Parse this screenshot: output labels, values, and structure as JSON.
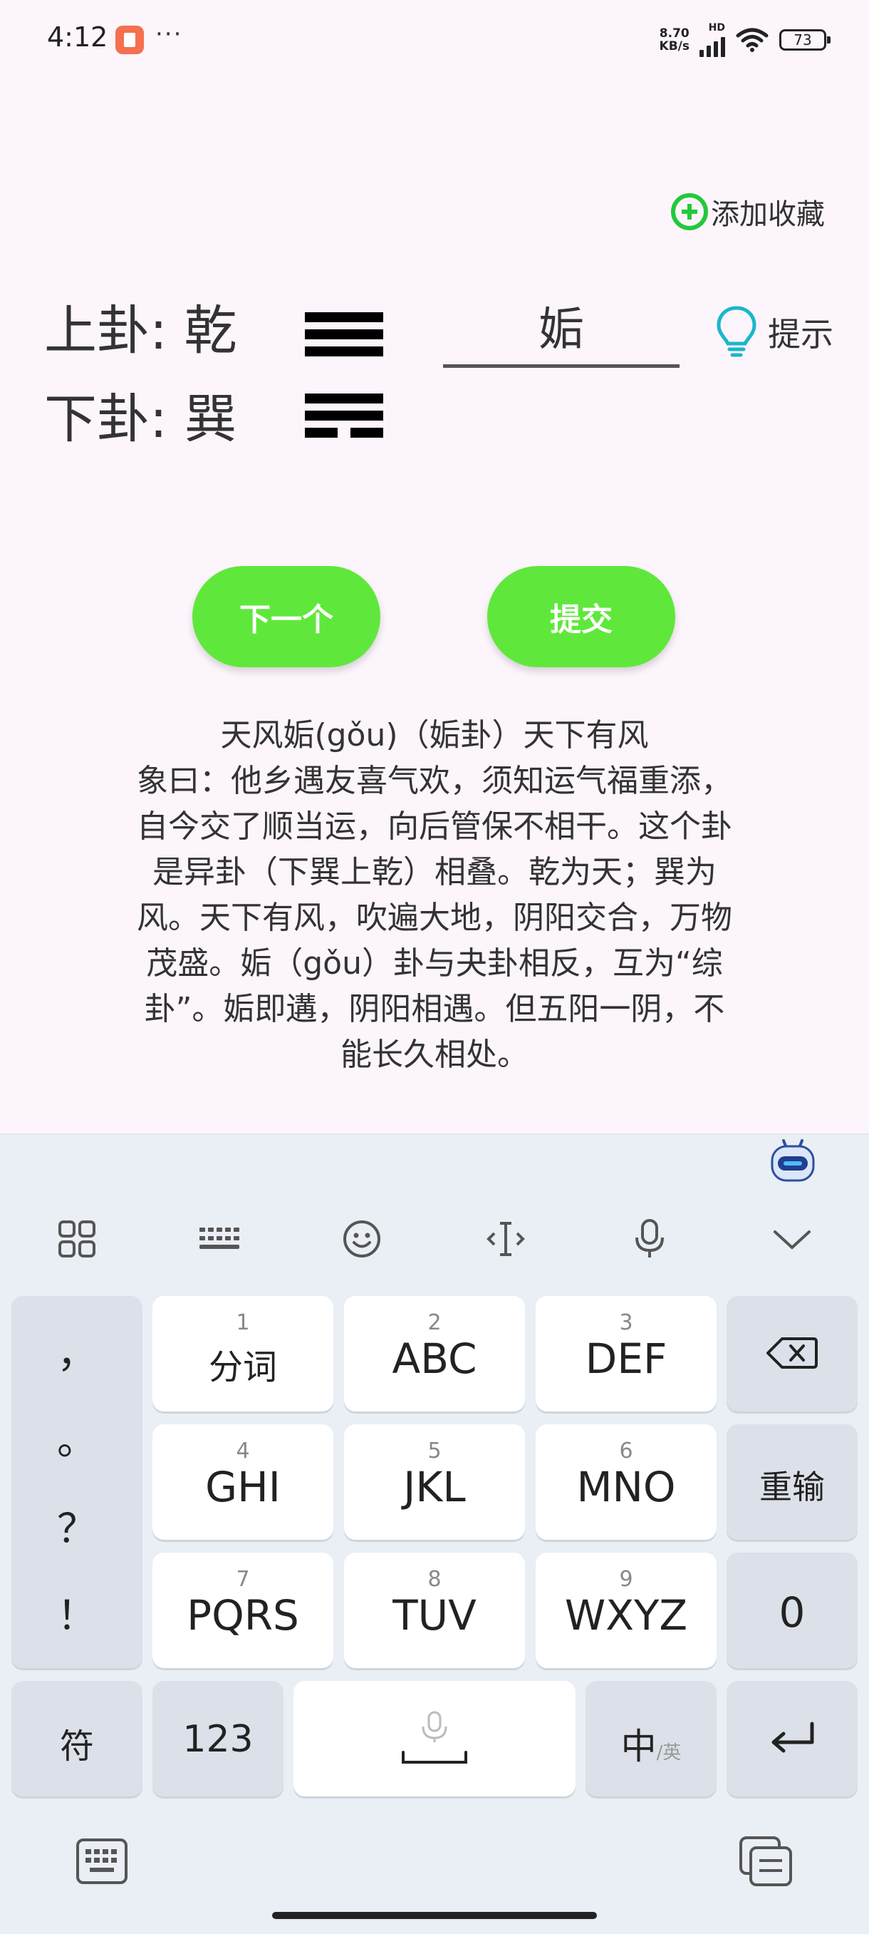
{
  "status_bar": {
    "time": "4:12",
    "more": "···",
    "net_speed_top": "8.70",
    "net_speed_bottom": "KB/s",
    "network": "HD",
    "battery": "73"
  },
  "favorite": {
    "label": "添加收藏"
  },
  "quiz": {
    "upper_label": "上卦: 乾",
    "lower_label": "下卦: 巽",
    "answer": "姤",
    "hint_label": "提示",
    "next_button": "下一个",
    "submit_button": "提交"
  },
  "trigrams": {
    "upper": [
      [
        1
      ],
      [
        1
      ],
      [
        1
      ]
    ],
    "lower": [
      [
        1
      ],
      [
        1
      ],
      [
        0,
        0
      ]
    ]
  },
  "description": {
    "lines": [
      "天风姤(gǒu)（姤卦）天下有风",
      "象曰：他乡遇友喜气欢，须知运气福重添，",
      "自今交了顺当运，向后管保不相干。这个卦",
      "是异卦（下巽上乾）相叠。乾为天；巽为",
      "风。天下有风，吹遍大地，阴阳交合，万物",
      "茂盛。姤（gǒu）卦与夬卦相反，互为“综",
      "卦”。姤即遘，阴阳相遇。但五阳一阴，不",
      "能长久相处。"
    ]
  },
  "keyboard": {
    "toolbar": [
      "apps-icon",
      "keyboard-icon",
      "emoji-icon",
      "cursor-icon",
      "mic-icon",
      "collapse-icon"
    ],
    "punctuation": [
      "，",
      "。",
      "？",
      "！"
    ],
    "keys": [
      {
        "num": "1",
        "label": "分词"
      },
      {
        "num": "2",
        "label": "ABC"
      },
      {
        "num": "3",
        "label": "DEF"
      },
      {
        "num": "4",
        "label": "GHI"
      },
      {
        "num": "5",
        "label": "JKL"
      },
      {
        "num": "6",
        "label": "MNO"
      },
      {
        "num": "7",
        "label": "PQRS"
      },
      {
        "num": "8",
        "label": "TUV"
      },
      {
        "num": "9",
        "label": "WXYZ"
      }
    ],
    "reinput": "重输",
    "zero": "0",
    "symbol": "符",
    "numbers": "123",
    "lang_main": "中",
    "lang_sub": "/英"
  },
  "colors": {
    "accent_green": "#5fe83b",
    "favorite_green": "#22c93b",
    "hint_cyan": "#1bb6c9"
  }
}
